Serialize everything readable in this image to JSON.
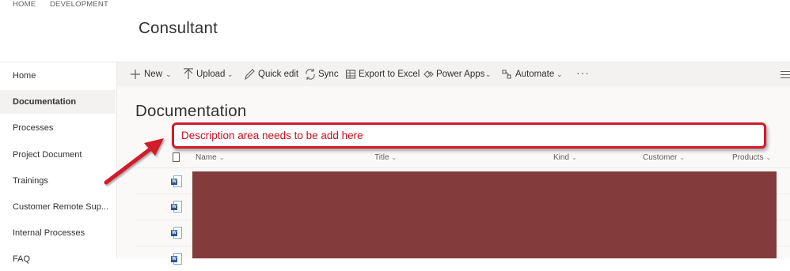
{
  "top_nav": {
    "home": "HOME",
    "development": "DEVELOPMENT"
  },
  "site_title": "Consultant",
  "sidebar": {
    "items": [
      {
        "label": "Home"
      },
      {
        "label": "Documentation",
        "active": true
      },
      {
        "label": "Processes"
      },
      {
        "label": "Project Document"
      },
      {
        "label": "Trainings"
      },
      {
        "label": "Customer Remote Sup..."
      },
      {
        "label": "Internal Processes"
      },
      {
        "label": "FAQ"
      }
    ]
  },
  "command_bar": {
    "new": "New",
    "upload": "Upload",
    "quick_edit": "Quick edit",
    "sync": "Sync",
    "export": "Export to Excel",
    "power_apps": "Power Apps",
    "automate": "Automate",
    "more": "···"
  },
  "library_title": "Documentation",
  "annotation": {
    "text": "Description area needs to be add here",
    "color": "#d11a2a"
  },
  "columns": {
    "name": "Name",
    "title": "Title",
    "kind": "Kind",
    "customer": "Customer",
    "products": "Products"
  },
  "rows": [
    {
      "icon": "word-doc-icon"
    },
    {
      "icon": "word-doc-icon"
    },
    {
      "icon": "word-doc-icon"
    },
    {
      "icon": "word-doc-icon"
    }
  ],
  "redacted_color": "#833b3c"
}
